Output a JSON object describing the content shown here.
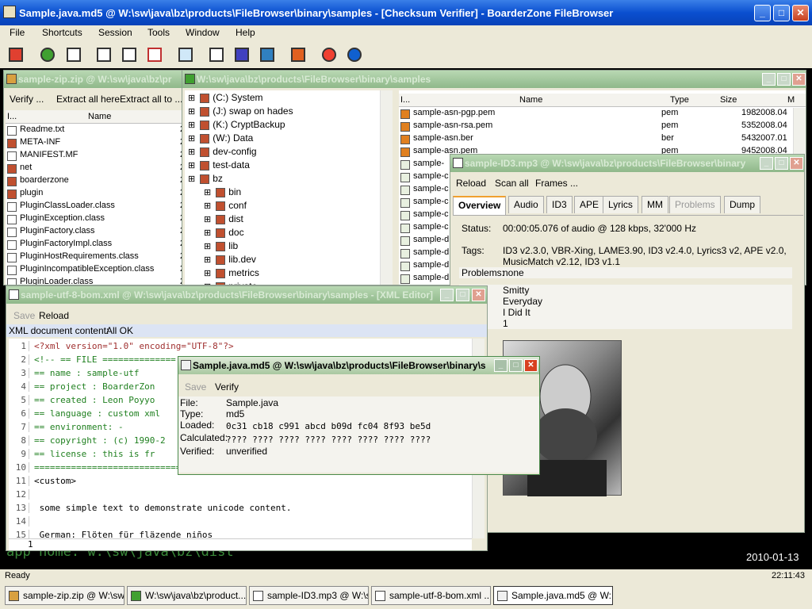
{
  "app": {
    "title": "Sample.java.md5 @ W:\\sw\\java\\bz\\products\\FileBrowser\\binary\\samples - [Checksum Verifier] - BoarderZone FileBrowser"
  },
  "menu": [
    "File",
    "Shortcuts",
    "Session",
    "Tools",
    "Window",
    "Help"
  ],
  "background": {
    "line1": "app home: w:\\sw\\java\\bz\\dist",
    "date": "2010-01-13"
  },
  "zip_window": {
    "title": "sample-zip.zip @ W:\\sw\\java\\bz\\pr",
    "buttons": [
      "Verify ...",
      "Extract all here",
      "Extract all to ..."
    ],
    "col_icon": "I...",
    "col_name": "Name",
    "files": [
      {
        "name": "Readme.txt",
        "s": "2",
        "icon": "doc"
      },
      {
        "name": "META-INF",
        "s": "2",
        "icon": "folder"
      },
      {
        "name": "MANIFEST.MF",
        "s": "2",
        "icon": "doc"
      },
      {
        "name": "net",
        "s": "2",
        "icon": "folder"
      },
      {
        "name": "boarderzone",
        "s": "2",
        "icon": "folder"
      },
      {
        "name": "plugin",
        "s": "2",
        "icon": "folder"
      },
      {
        "name": "PluginClassLoader.class",
        "s": "2",
        "icon": "q"
      },
      {
        "name": "PluginException.class",
        "s": "2",
        "icon": "q"
      },
      {
        "name": "PluginFactory.class",
        "s": "2",
        "icon": "q"
      },
      {
        "name": "PluginFactoryImpl.class",
        "s": "2",
        "icon": "q"
      },
      {
        "name": "PluginHostRequirements.class",
        "s": "2",
        "icon": "q"
      },
      {
        "name": "PluginIncompatibleException.class",
        "s": "2",
        "icon": "q"
      },
      {
        "name": "PluginLoader.class",
        "s": "2",
        "icon": "q"
      }
    ]
  },
  "browser_window": {
    "title": "W:\\sw\\java\\bz\\products\\FileBrowser\\binary\\samples",
    "tree": [
      {
        "label": "(C:) System",
        "lvl": 0
      },
      {
        "label": "(J:) swap on hades",
        "lvl": 0
      },
      {
        "label": "(K:) CryptBackup",
        "lvl": 0
      },
      {
        "label": "(W:) Data",
        "lvl": 0
      },
      {
        "label": "dev-config",
        "lvl": 0
      },
      {
        "label": "test-data",
        "lvl": 0
      },
      {
        "label": "bz",
        "lvl": 0
      },
      {
        "label": "bin",
        "lvl": 1
      },
      {
        "label": "conf",
        "lvl": 1
      },
      {
        "label": "dist",
        "lvl": 1
      },
      {
        "label": "doc",
        "lvl": 1
      },
      {
        "label": "lib",
        "lvl": 1
      },
      {
        "label": "lib.dev",
        "lvl": 1
      },
      {
        "label": "metrics",
        "lvl": 1
      },
      {
        "label": "private",
        "lvl": 1
      }
    ],
    "cols": {
      "icon": "I...",
      "name": "Name",
      "type": "Type",
      "size": "Size",
      "date": "M"
    },
    "files": [
      {
        "name": "sample-asn-pgp.pem",
        "type": "pem",
        "size": "198",
        "date": "2008.04"
      },
      {
        "name": "sample-asn-rsa.pem",
        "type": "pem",
        "size": "535",
        "date": "2008.04"
      },
      {
        "name": "sample-asn.ber",
        "type": "ber",
        "size": "543",
        "date": "2007.01"
      },
      {
        "name": "sample-asn.pem",
        "type": "pem",
        "size": "945",
        "date": "2008.04"
      },
      {
        "name": "sample-",
        "type": "",
        "size": "",
        "date": ""
      },
      {
        "name": "sample-c",
        "type": "",
        "size": "",
        "date": ""
      },
      {
        "name": "sample-c",
        "type": "",
        "size": "",
        "date": ""
      },
      {
        "name": "sample-c",
        "type": "",
        "size": "",
        "date": ""
      },
      {
        "name": "sample-c",
        "type": "",
        "size": "",
        "date": ""
      },
      {
        "name": "sample-c",
        "type": "",
        "size": "",
        "date": ""
      },
      {
        "name": "sample-d",
        "type": "",
        "size": "",
        "date": ""
      },
      {
        "name": "sample-d",
        "type": "",
        "size": "",
        "date": ""
      },
      {
        "name": "sample-d",
        "type": "",
        "size": "",
        "date": ""
      },
      {
        "name": "sample-d",
        "type": "",
        "size": "",
        "date": ""
      }
    ]
  },
  "mp3_window": {
    "title": "sample-ID3.mp3 @ W:\\sw\\java\\bz\\products\\FileBrowser\\binary",
    "buttons": [
      "Reload",
      "Scan all",
      "Frames ..."
    ],
    "tabs": [
      "Overview",
      "Audio",
      "ID3",
      "APE",
      "Lyrics",
      "MM",
      "Problems",
      "Dump"
    ],
    "status_label": "Status:",
    "status_value": "00:00:05.076 of audio @ 128 kbps, 32'000 Hz",
    "tags_label": "Tags:",
    "tags_value": "ID3 v2.3.0, VBR-Xing, LAME3.90, ID3 v2.4.0, Lyrics3 v2, APE v2.0, MusicMatch v2.12, ID3 v1.1",
    "problems_label": "Problems:",
    "problems_value": "none",
    "meta_lines": [
      "Smitty",
      "Everyday",
      "I Did It",
      "1"
    ]
  },
  "xml_window": {
    "title": "sample-utf-8-bom.xml @ W:\\sw\\java\\bz\\products\\FileBrowser\\binary\\samples - [XML Editor]",
    "buttons": [
      "Save",
      "Reload"
    ],
    "status_label": "XML document content:",
    "status_value": "All OK",
    "line_numbers": [
      "1",
      "2",
      "3",
      "4",
      "5",
      "6",
      "7",
      "8",
      "9",
      "10",
      "11",
      "12",
      "13",
      "14",
      "15"
    ],
    "lines": [
      "<?xml version=\"1.0\" encoding=\"UTF-8\"?>",
      "<!-- == FILE ==============",
      "== name       : sample-utf",
      "== project    : BoarderZon",
      "== created    : Leon Poyyo",
      "== language   : custom xml",
      "== environment: -",
      "== copyright  : (c) 1990-2",
      "== license    : this is fr",
      "=============================",
      "<custom>",
      "",
      "  some simple text to demonstrate unicode content.",
      "",
      "  German:   Flöten für fläzende niños"
    ],
    "footer_line": "1"
  },
  "md5_window": {
    "title": "Sample.java.md5 @ W:\\sw\\java\\bz\\products\\FileBrowser\\binary\\s",
    "buttons": [
      "Save",
      "Verify"
    ],
    "file_label": "File:",
    "file_value": "Sample.java",
    "type_label": "Type:",
    "type_value": "md5",
    "loaded_label": "Loaded:",
    "loaded_value": "0c31 cb18 c991 abcd b09d fc04 8f93 be5d",
    "calc_label": "Calculated:",
    "calc_value": "???? ???? ???? ???? ???? ???? ???? ????",
    "verified_label": "Verified:",
    "verified_value": "unverified"
  },
  "status": {
    "left": "Ready",
    "right": "22:11:43"
  },
  "tasks": [
    {
      "label": "sample-zip.zip @ W:\\sw..."
    },
    {
      "label": "W:\\sw\\java\\bz\\product..."
    },
    {
      "label": "sample-ID3.mp3 @ W:\\s..."
    },
    {
      "label": "sample-utf-8-bom.xml ..."
    },
    {
      "label": "Sample.java.md5 @ W:..."
    }
  ]
}
